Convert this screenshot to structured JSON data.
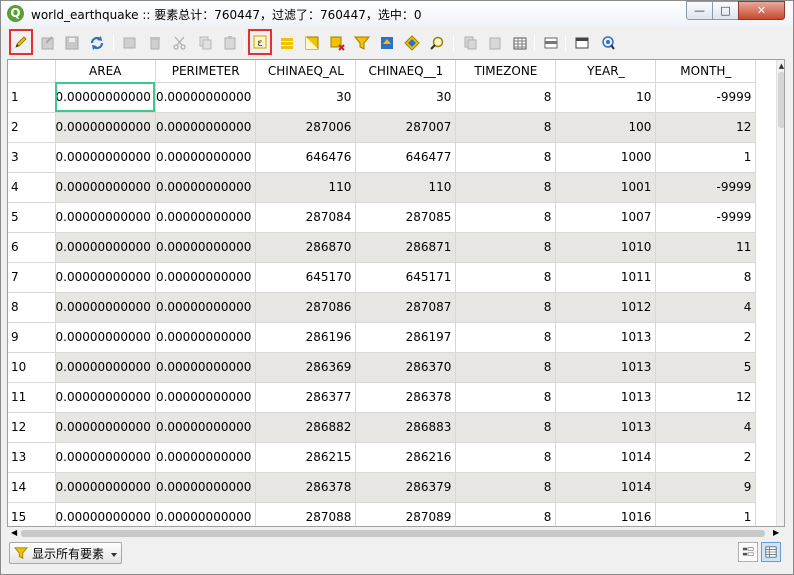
{
  "window": {
    "title": "world_earthquake :: 要素总计：760447，过滤了：760447，选中：0",
    "min_glyph": "—",
    "max_glyph": "□",
    "close_glyph": "✕"
  },
  "toolbar": {
    "icons": [
      "edit-pencil-icon",
      "save-edits-icon",
      "save-icon",
      "reload-icon",
      "add-feature-icon",
      "delete-feature-icon",
      "cut-icon",
      "copy-icon",
      "paste-icon",
      "select-by-expression-icon",
      "select-all-icon",
      "invert-selection-icon",
      "deselect-icon",
      "filter-icon",
      "move-selection-top-icon",
      "pan-to-selection-icon",
      "zoom-to-selection-icon",
      "copy-rows-icon",
      "paste-features-icon",
      "delete-field-icon",
      "new-field-icon",
      "field-calculator-icon",
      "conditional-format-icon",
      "dock-icon"
    ]
  },
  "table": {
    "columns": [
      "AREA",
      "PERIMETER",
      "CHINAEQ_AL",
      "CHINAEQ__1",
      "TIMEZONE",
      "YEAR_",
      "MONTH_"
    ],
    "rows": [
      [
        "1",
        "0.00000000000",
        "0.00000000000",
        "30",
        "30",
        "8",
        "10",
        "-9999"
      ],
      [
        "2",
        "0.00000000000",
        "0.00000000000",
        "287006",
        "287007",
        "8",
        "100",
        "12"
      ],
      [
        "3",
        "0.00000000000",
        "0.00000000000",
        "646476",
        "646477",
        "8",
        "1000",
        "1"
      ],
      [
        "4",
        "0.00000000000",
        "0.00000000000",
        "110",
        "110",
        "8",
        "1001",
        "-9999"
      ],
      [
        "5",
        "0.00000000000",
        "0.00000000000",
        "287084",
        "287085",
        "8",
        "1007",
        "-9999"
      ],
      [
        "6",
        "0.00000000000",
        "0.00000000000",
        "286870",
        "286871",
        "8",
        "1010",
        "11"
      ],
      [
        "7",
        "0.00000000000",
        "0.00000000000",
        "645170",
        "645171",
        "8",
        "1011",
        "8"
      ],
      [
        "8",
        "0.00000000000",
        "0.00000000000",
        "287086",
        "287087",
        "8",
        "1012",
        "4"
      ],
      [
        "9",
        "0.00000000000",
        "0.00000000000",
        "286196",
        "286197",
        "8",
        "1013",
        "2"
      ],
      [
        "10",
        "0.00000000000",
        "0.00000000000",
        "286369",
        "286370",
        "8",
        "1013",
        "5"
      ],
      [
        "11",
        "0.00000000000",
        "0.00000000000",
        "286377",
        "286378",
        "8",
        "1013",
        "12"
      ],
      [
        "12",
        "0.00000000000",
        "0.00000000000",
        "286882",
        "286883",
        "8",
        "1013",
        "4"
      ],
      [
        "13",
        "0.00000000000",
        "0.00000000000",
        "286215",
        "286216",
        "8",
        "1014",
        "2"
      ],
      [
        "14",
        "0.00000000000",
        "0.00000000000",
        "286378",
        "286379",
        "8",
        "1014",
        "9"
      ],
      [
        "15",
        "0.00000000000",
        "0.00000000000",
        "287088",
        "287089",
        "8",
        "1016",
        "1"
      ]
    ],
    "selected_cell": "AREA row 1"
  },
  "footer": {
    "filter_label": "显示所有要素",
    "filter_icon": "filter-icon",
    "view_icons": [
      "form-view-icon",
      "table-view-icon"
    ]
  },
  "colors": {
    "highlight_box": "#e43030",
    "selected_cell": "#3cc98c",
    "alt_row": "#e8e6e3"
  }
}
